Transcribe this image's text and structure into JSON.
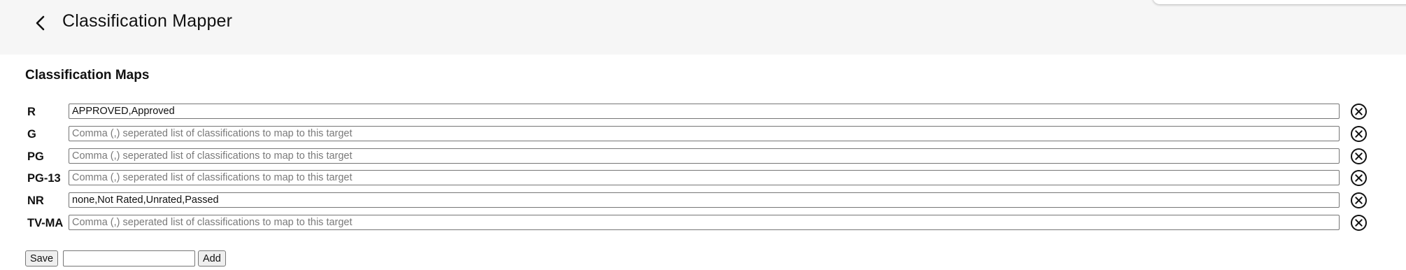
{
  "header": {
    "title": "Classification Mapper",
    "back_icon": "chevron-left-icon"
  },
  "section": {
    "title": "Classification Maps"
  },
  "maps": [
    {
      "label": "R",
      "value": "APPROVED,Approved",
      "placeholder": "Comma (,) seperated list of classifications to map to this target"
    },
    {
      "label": "G",
      "value": "",
      "placeholder": "Comma (,) seperated list of classifications to map to this target"
    },
    {
      "label": "PG",
      "value": "",
      "placeholder": "Comma (,) seperated list of classifications to map to this target"
    },
    {
      "label": "PG-13",
      "value": "",
      "placeholder": "Comma (,) seperated list of classifications to map to this target"
    },
    {
      "label": "NR",
      "value": "none,Not Rated,Unrated,Passed",
      "placeholder": "Comma (,) seperated list of classifications to map to this target"
    },
    {
      "label": "TV-MA",
      "value": "",
      "placeholder": "Comma (,) seperated list of classifications to map to this target"
    }
  ],
  "remove_icon": "circle-x-icon",
  "footer": {
    "save_label": "Save",
    "new_target_value": "",
    "add_label": "Add"
  },
  "colors": {
    "header_bg": "#f6f6f6",
    "page_bg": "#ffffff",
    "input_border": "#767676",
    "button_bg": "#efefef"
  }
}
